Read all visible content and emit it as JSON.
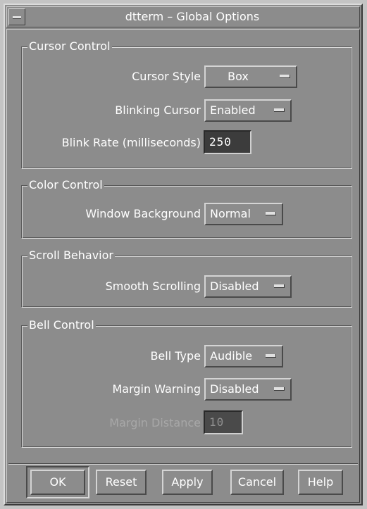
{
  "window": {
    "title": "dtterm – Global Options",
    "menu_icon": "window-menu-icon"
  },
  "cursor_control": {
    "title": "Cursor Control",
    "cursor_style": {
      "label": "Cursor Style",
      "value": "Box"
    },
    "blinking_cursor": {
      "label": "Blinking Cursor",
      "value": "Enabled"
    },
    "blink_rate": {
      "label": "Blink Rate (milliseconds)",
      "value": "250"
    }
  },
  "color_control": {
    "title": "Color Control",
    "window_background": {
      "label": "Window Background",
      "value": "Normal"
    }
  },
  "scroll_behavior": {
    "title": "Scroll Behavior",
    "smooth_scrolling": {
      "label": "Smooth Scrolling",
      "value": "Disabled"
    }
  },
  "bell_control": {
    "title": "Bell Control",
    "bell_type": {
      "label": "Bell Type",
      "value": "Audible"
    },
    "margin_warning": {
      "label": "Margin Warning",
      "value": "Disabled"
    },
    "margin_distance": {
      "label": "Margin Distance",
      "value": "10"
    }
  },
  "buttons": {
    "ok": "OK",
    "reset": "Reset",
    "apply": "Apply",
    "cancel": "Cancel",
    "help": "Help"
  }
}
